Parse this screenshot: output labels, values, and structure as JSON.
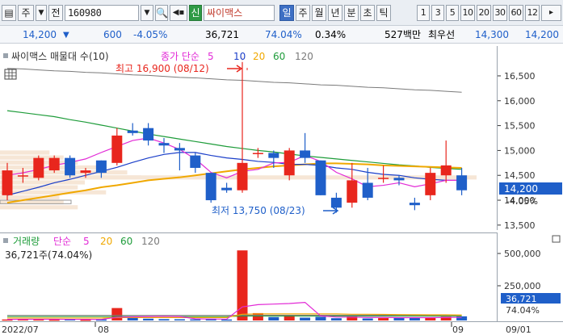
{
  "toolbar": {
    "market_label": "주",
    "period_label": "전",
    "stock_code": "160980",
    "stock_name": "싸이맥스",
    "period_buttons": [
      "일",
      "주",
      "월",
      "년",
      "분",
      "초",
      "틱"
    ],
    "interval_buttons": [
      "1",
      "3",
      "5",
      "10",
      "20",
      "30",
      "60",
      "12"
    ]
  },
  "info": {
    "price": "14,200",
    "change": "600",
    "change_pct": "-4.05%",
    "volume": "36,721",
    "volume_ratio": "74.04%",
    "turnover": "0.34%",
    "amount": "527백만",
    "bid_label": "최우선",
    "bid": "14,300",
    "ask": "14,200"
  },
  "price_pane": {
    "legend_title": "싸이맥스 매물대 수(10)",
    "legend_ma_label": "종가 단순",
    "legend_periods": [
      "5",
      "10",
      "20",
      "60",
      "120"
    ],
    "high_annotation": "최고 16,900 (08/12)",
    "low_annotation": "최저 13,750 (08/23)",
    "axis_ticks": [
      "16,500",
      "16,000",
      "15,500",
      "15,000",
      "14,500",
      "14,000",
      "13,500"
    ],
    "current_price_label": "14,200",
    "current_change_label": "-4.05%"
  },
  "volume_pane": {
    "legend_title": "거래량",
    "legend_ma_label": "단순",
    "legend_periods": [
      "5",
      "20",
      "60",
      "120"
    ],
    "current_volume_text": "36,721주(74.04%)",
    "axis_ticks": [
      "500,000",
      "250,000"
    ],
    "current_volume_label": "36,721",
    "current_ratio_label": "74.04%"
  },
  "time_axis": {
    "labels": [
      "2022/07",
      "08",
      "09",
      "09/01"
    ]
  },
  "colors": {
    "up": "#e8261d",
    "down": "#1f5fc9",
    "ma5": "#e22ad6",
    "ma10": "#1a3ec9",
    "ma20": "#f0a800",
    "ma60": "#1e9c3a",
    "ma120": "#7a7a7a",
    "volume_profile": "#f6e6d6",
    "accent": "#3d6fc4"
  },
  "chart_data": [
    {
      "type": "candlestick",
      "title": "싸이맥스 매물대 수(10)",
      "y_range": [
        13400,
        17100
      ],
      "high_label": "최고 16,900 (08/12)",
      "low_label": "최저 13,750 (08/23)",
      "candles": [
        {
          "o": 14100,
          "h": 14750,
          "l": 14000,
          "c": 14600
        },
        {
          "o": 14500,
          "h": 14650,
          "l": 14350,
          "c": 14500
        },
        {
          "o": 14450,
          "h": 14900,
          "l": 14400,
          "c": 14850
        },
        {
          "o": 14600,
          "h": 14900,
          "l": 14550,
          "c": 14850
        },
        {
          "o": 14850,
          "h": 14900,
          "l": 14450,
          "c": 14500
        },
        {
          "o": 14550,
          "h": 14650,
          "l": 14450,
          "c": 14600
        },
        {
          "o": 14800,
          "h": 14800,
          "l": 14450,
          "c": 14550
        },
        {
          "o": 14750,
          "h": 15450,
          "l": 14700,
          "c": 15300
        },
        {
          "o": 15400,
          "h": 15550,
          "l": 15300,
          "c": 15350
        },
        {
          "o": 15450,
          "h": 15550,
          "l": 15100,
          "c": 15200
        },
        {
          "o": 15150,
          "h": 15250,
          "l": 14950,
          "c": 15100
        },
        {
          "o": 15050,
          "h": 15150,
          "l": 14600,
          "c": 15000
        },
        {
          "o": 14900,
          "h": 14950,
          "l": 14550,
          "c": 14650
        },
        {
          "o": 14550,
          "h": 14550,
          "l": 13950,
          "c": 14000
        },
        {
          "o": 14250,
          "h": 14350,
          "l": 14150,
          "c": 14200
        },
        {
          "o": 14200,
          "h": 16900,
          "l": 14150,
          "c": 14750
        },
        {
          "o": 14950,
          "h": 15050,
          "l": 14850,
          "c": 14950
        },
        {
          "o": 14950,
          "h": 15000,
          "l": 14650,
          "c": 14850
        },
        {
          "o": 14500,
          "h": 15050,
          "l": 14400,
          "c": 15000
        },
        {
          "o": 15000,
          "h": 15350,
          "l": 14750,
          "c": 14850
        },
        {
          "o": 14800,
          "h": 14800,
          "l": 14100,
          "c": 14100
        },
        {
          "o": 14050,
          "h": 14150,
          "l": 13750,
          "c": 13850
        },
        {
          "o": 13950,
          "h": 14750,
          "l": 13850,
          "c": 14400
        },
        {
          "o": 14350,
          "h": 14650,
          "l": 14000,
          "c": 14050
        },
        {
          "o": 14450,
          "h": 14700,
          "l": 14350,
          "c": 14450
        },
        {
          "o": 14450,
          "h": 14500,
          "l": 14300,
          "c": 14400
        },
        {
          "o": 13950,
          "h": 14050,
          "l": 13800,
          "c": 13900
        },
        {
          "o": 14100,
          "h": 14650,
          "l": 14000,
          "c": 14550
        },
        {
          "o": 14500,
          "h": 15200,
          "l": 14350,
          "c": 14700
        },
        {
          "o": 14500,
          "h": 14650,
          "l": 14100,
          "c": 14200
        }
      ],
      "ma5": [
        14500,
        14550,
        14620,
        14700,
        14760,
        14830,
        14960,
        15080,
        15200,
        15250,
        15150,
        15020,
        14830,
        14560,
        14450,
        14580,
        14620,
        14750,
        14760,
        14900,
        14780,
        14560,
        14430,
        14270,
        14300,
        14350,
        14270,
        14330,
        14400,
        14400
      ],
      "ma10": [
        14100,
        14180,
        14260,
        14350,
        14420,
        14500,
        14580,
        14660,
        14760,
        14850,
        14920,
        14960,
        14960,
        14900,
        14850,
        14820,
        14780,
        14760,
        14720,
        14720,
        14700,
        14650,
        14620,
        14560,
        14520,
        14500,
        14450,
        14420,
        14400,
        14400
      ],
      "ma20": [
        13950,
        14000,
        14050,
        14100,
        14150,
        14200,
        14260,
        14300,
        14350,
        14400,
        14430,
        14460,
        14500,
        14540,
        14580,
        14620,
        14650,
        14680,
        14700,
        14720,
        14740,
        14740,
        14730,
        14720,
        14700,
        14690,
        14680,
        14670,
        14660,
        14650
      ],
      "ma60": [
        15800,
        15760,
        15720,
        15680,
        15620,
        15570,
        15510,
        15450,
        15390,
        15330,
        15280,
        15230,
        15180,
        15130,
        15080,
        15040,
        15000,
        14970,
        14930,
        14890,
        14860,
        14830,
        14800,
        14770,
        14740,
        14710,
        14690,
        14660,
        14640,
        14620
      ],
      "ma120": [
        16650,
        16640,
        16620,
        16600,
        16590,
        16570,
        16560,
        16540,
        16520,
        16510,
        16490,
        16470,
        16460,
        16440,
        16420,
        16410,
        16390,
        16370,
        16360,
        16340,
        16320,
        16310,
        16290,
        16270,
        16260,
        16240,
        16220,
        16210,
        16190,
        16170
      ],
      "volume_profile": [
        {
          "price": 13850,
          "share": 0.55
        },
        {
          "price": 13950,
          "share": 0.45
        },
        {
          "price": 14050,
          "share": 0.42
        },
        {
          "price": 14150,
          "share": 0.75
        },
        {
          "price": 14250,
          "share": 0.55
        },
        {
          "price": 14350,
          "share": 0.6
        },
        {
          "price": 14450,
          "share": 1.0
        },
        {
          "price": 14550,
          "share": 0.9
        },
        {
          "price": 14650,
          "share": 0.75
        },
        {
          "price": 14750,
          "share": 0.55
        },
        {
          "price": 14850,
          "share": 0.45
        },
        {
          "price": 14950,
          "share": 0.35
        }
      ]
    },
    {
      "type": "bar",
      "title": "거래량",
      "y_range": [
        0,
        600000
      ],
      "volumes": [
        9000,
        12000,
        10000,
        8000,
        13000,
        7000,
        9000,
        110000,
        25000,
        16000,
        12000,
        11000,
        10000,
        16000,
        9000,
        620000,
        65000,
        30000,
        42000,
        25000,
        32000,
        20000,
        38000,
        18000,
        21000,
        24000,
        26000,
        28000,
        34000,
        36721
      ],
      "ma5": [
        10000,
        10500,
        11000,
        10500,
        10400,
        10000,
        9400,
        29000,
        32000,
        35000,
        37000,
        35000,
        15000,
        13000,
        12000,
        120000,
        140000,
        145000,
        150000,
        160000,
        40000,
        30000,
        30000,
        27000,
        27000,
        25000,
        25000,
        25000,
        27000,
        28000
      ],
      "ma20": [
        22000,
        22000,
        22000,
        22000,
        22000,
        22000,
        22000,
        26000,
        26000,
        26000,
        26000,
        26000,
        26000,
        26000,
        26000,
        55000,
        58000,
        58000,
        58000,
        58000,
        58000,
        58000,
        55000,
        55000,
        54000,
        52000,
        51000,
        50000,
        50000,
        48000
      ],
      "ma60": [
        35000,
        35000,
        35000,
        35000,
        35000,
        35000,
        35000,
        35000,
        35000,
        35000,
        35000,
        35000,
        35000,
        35000,
        35000,
        38000,
        38000,
        38000,
        38000,
        38000,
        38000,
        38000,
        38000,
        38000,
        38000,
        38000,
        38000,
        38000,
        38000,
        38000
      ],
      "ma120": [
        45000,
        45000,
        45000,
        45000,
        45000,
        45000,
        45000,
        45000,
        45000,
        45000,
        45000,
        45000,
        45000,
        45000,
        45000,
        46000,
        46000,
        46000,
        46000,
        46000,
        46000,
        46000,
        46000,
        46000,
        46000,
        46000,
        46000,
        46000,
        46000,
        46000
      ]
    }
  ]
}
